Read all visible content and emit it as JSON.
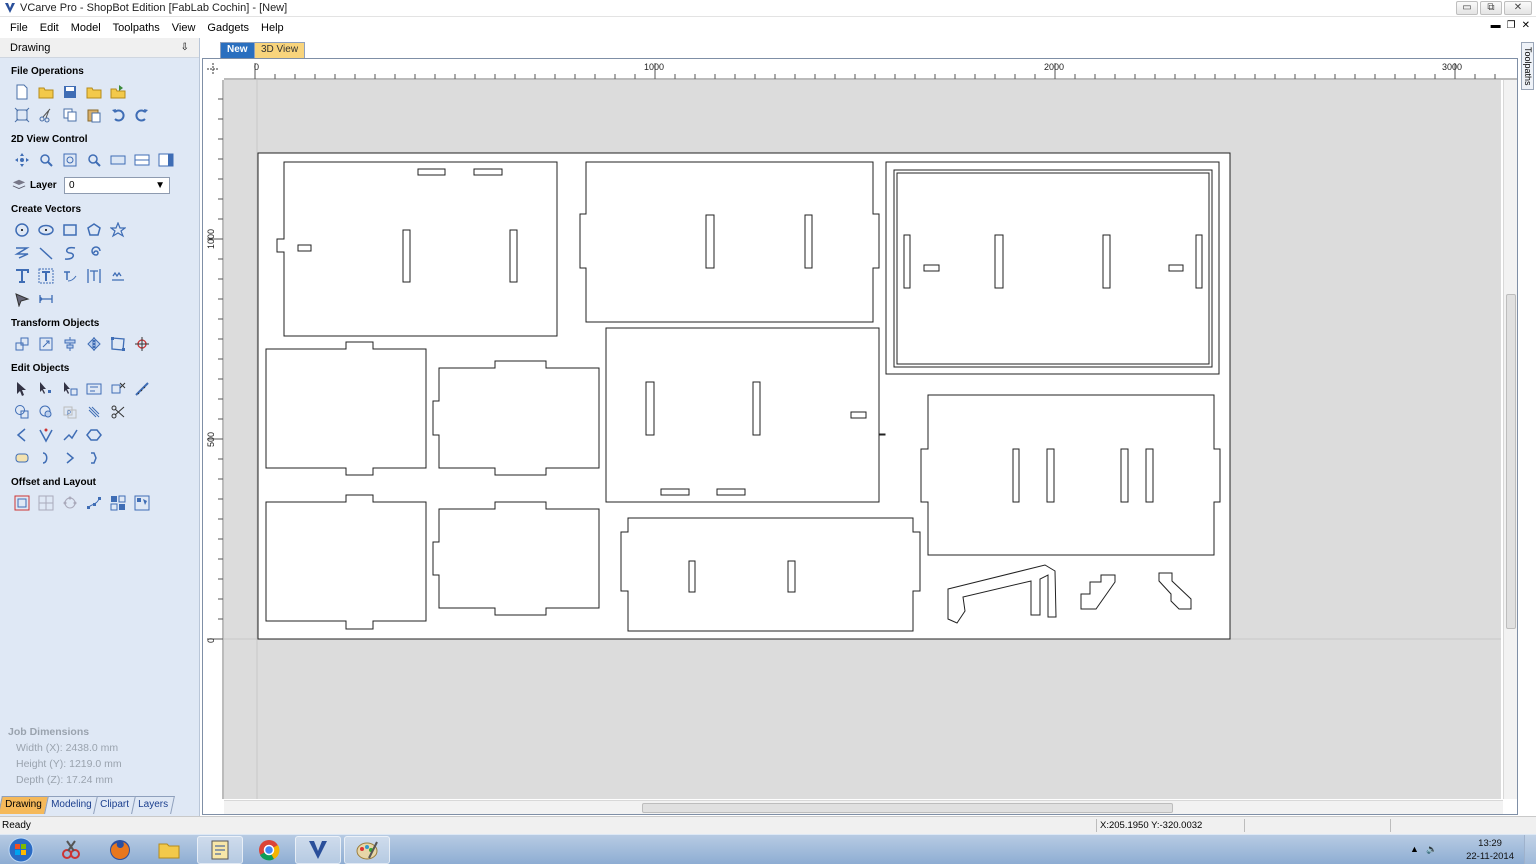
{
  "window": {
    "title": "VCarve Pro - ShopBot Edition [FabLab Cochin] - [New]",
    "controls": [
      "▭",
      "⧉",
      "✕"
    ]
  },
  "menu": [
    "File",
    "Edit",
    "Model",
    "Toolpaths",
    "View",
    "Gadgets",
    "Help"
  ],
  "mdi_controls": [
    "▬",
    "❐",
    "✕"
  ],
  "left_panel": {
    "header": "Drawing",
    "pin": "⇩",
    "sections": {
      "file_ops": "File Operations",
      "view_control": "2D View Control",
      "create_vectors": "Create Vectors",
      "transform": "Transform Objects",
      "edit": "Edit Objects",
      "offset": "Offset and Layout"
    },
    "layer_label": "Layer",
    "layer_value": "0",
    "job_dimensions": {
      "title": "Job Dimensions",
      "width": "Width  (X): 2438.0 mm",
      "height": "Height (Y): 1219.0 mm",
      "depth": "Depth  (Z): 17.24 mm"
    },
    "tabs": [
      "Drawing",
      "Modeling",
      "Clipart",
      "Layers"
    ]
  },
  "doc_tabs": [
    "New",
    "3D View"
  ],
  "right_tab": "Toolpaths",
  "ruler": {
    "h_labels": [
      "0",
      "1000",
      "2000",
      "3000"
    ],
    "v_labels": [
      "1000",
      "500",
      "0"
    ]
  },
  "status": {
    "ready": "Ready",
    "coords": "X:205.1950 Y:-320.0032"
  },
  "taskbar": {
    "time": "13:29",
    "date": "22-11-2014"
  }
}
